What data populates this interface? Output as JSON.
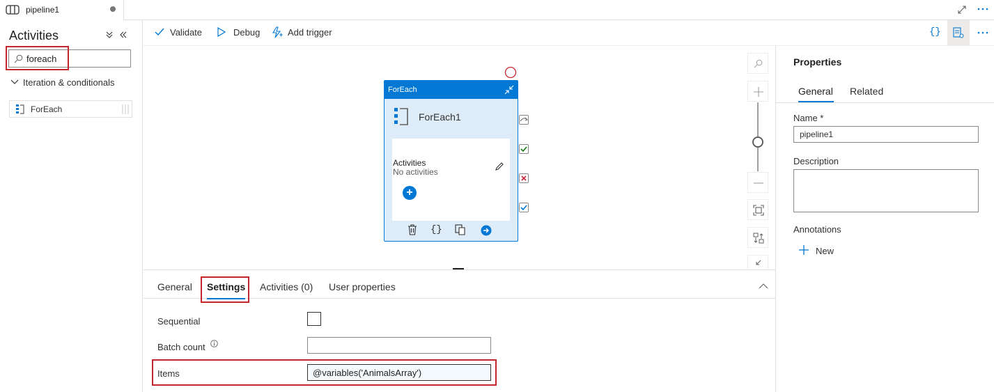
{
  "tab": {
    "title": "pipeline1",
    "icon": "pipeline-icon"
  },
  "activities_panel": {
    "title": "Activities",
    "search_value": "foreach",
    "group_label": "Iteration & conditionals",
    "items": [
      {
        "label": "ForEach",
        "icon": "foreach-icon"
      }
    ]
  },
  "toolbar": {
    "validate": "Validate",
    "debug": "Debug",
    "add_trigger": "Add trigger"
  },
  "canvas": {
    "node": {
      "type_label": "ForEach",
      "name": "ForEach1",
      "inner_title": "Activities",
      "inner_subtitle": "No activities"
    }
  },
  "bottom_panel": {
    "tabs": [
      {
        "label": "General",
        "active": false
      },
      {
        "label": "Settings",
        "active": true
      },
      {
        "label": "Activities (0)",
        "active": false
      },
      {
        "label": "User properties",
        "active": false
      }
    ],
    "fields": {
      "sequential_label": "Sequential",
      "sequential_checked": false,
      "batch_count_label": "Batch count",
      "batch_count_value": "",
      "items_label": "Items",
      "items_value": "@variables('AnimalsArray')"
    }
  },
  "properties": {
    "title": "Properties",
    "tabs": [
      {
        "label": "General",
        "active": true
      },
      {
        "label": "Related",
        "active": false
      }
    ],
    "name_label": "Name *",
    "name_value": "pipeline1",
    "description_label": "Description",
    "description_value": "",
    "annotations_label": "Annotations",
    "new_label": "New"
  },
  "colors": {
    "accent": "#0078d4",
    "highlight": "#c4262e",
    "node_bg": "#deecf9"
  }
}
